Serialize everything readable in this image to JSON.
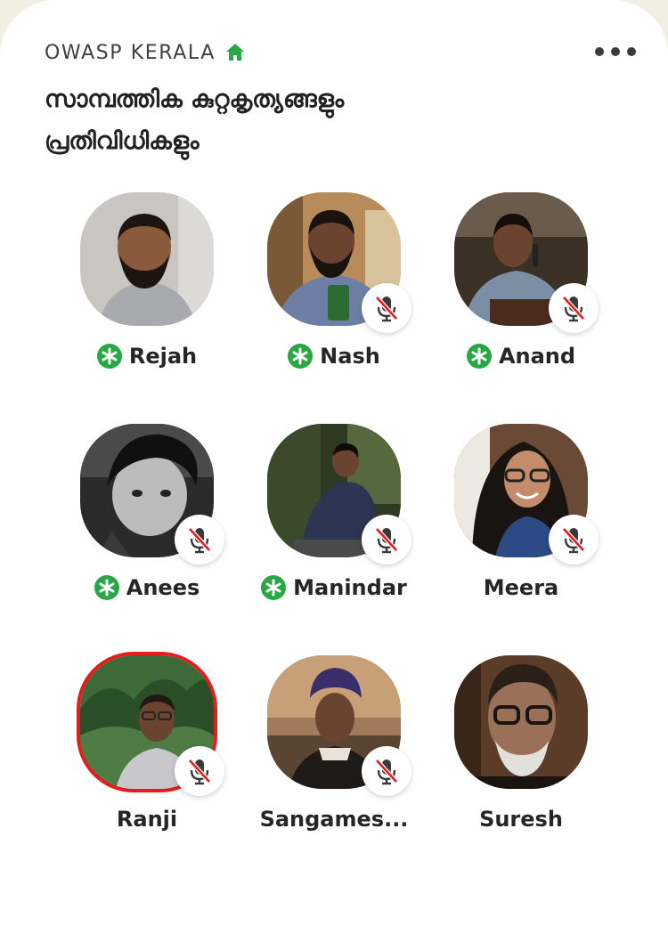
{
  "header": {
    "club_name": "OWASP KERALA",
    "club_icon": "house-icon",
    "more_icon": "more-dots-icon",
    "room_title_line1": "സാമ്പത്തിക കുറ്റകൃത്യങ്ങളും",
    "room_title_line2": "പ്രതിവിധികളും"
  },
  "colors": {
    "background": "#f1efe4",
    "card": "#ffffff",
    "moderator_green": "#27a844",
    "mute_red": "#e41c1c",
    "speaking_ring": "#e41c1c",
    "text_dark": "#262626"
  },
  "speakers": [
    {
      "name": "Rejah",
      "moderator": true,
      "muted": false,
      "speaking": false
    },
    {
      "name": "Nash",
      "moderator": true,
      "muted": true,
      "speaking": false
    },
    {
      "name": "Anand",
      "moderator": true,
      "muted": true,
      "speaking": false
    },
    {
      "name": "Anees",
      "moderator": true,
      "muted": true,
      "speaking": false
    },
    {
      "name": "Manindar",
      "moderator": true,
      "muted": true,
      "speaking": false
    },
    {
      "name": "Meera",
      "moderator": false,
      "muted": true,
      "speaking": false
    },
    {
      "name": "Ranji",
      "moderator": false,
      "muted": true,
      "speaking": true
    },
    {
      "name": "Sangames...",
      "moderator": false,
      "muted": true,
      "speaking": false
    },
    {
      "name": "Suresh",
      "moderator": false,
      "muted": false,
      "speaking": false
    }
  ]
}
